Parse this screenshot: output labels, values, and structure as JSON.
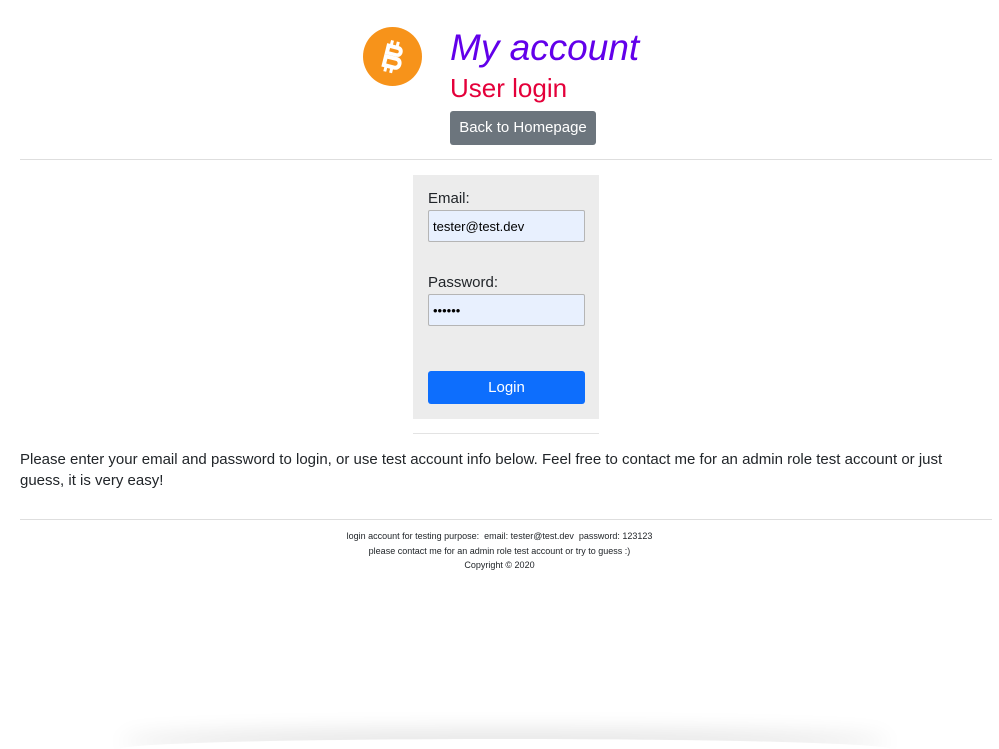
{
  "header": {
    "logo_icon": "bitcoin-icon",
    "logo_color": "#f7931a",
    "title": "My account",
    "title_color": "#6200ea",
    "subtitle": "User login",
    "subtitle_color": "#e4003a",
    "back_label": "Back to Homepage"
  },
  "form": {
    "email_label": "Email:",
    "email_value": "tester@test.dev",
    "password_label": "Password:",
    "password_value": "123123",
    "login_label": "Login",
    "login_color": "#0d6efd"
  },
  "info_text": "Please enter your email and password to login, or use test account info below. Feel free to contact me for an admin role test account or just guess, it is very easy!",
  "footer": {
    "line1": "login account for testing purpose:  email: tester@test.dev  password: 123123",
    "line2": "please contact me for an admin role test account or try to guess :)",
    "copyright": "Copyright © 2020"
  }
}
